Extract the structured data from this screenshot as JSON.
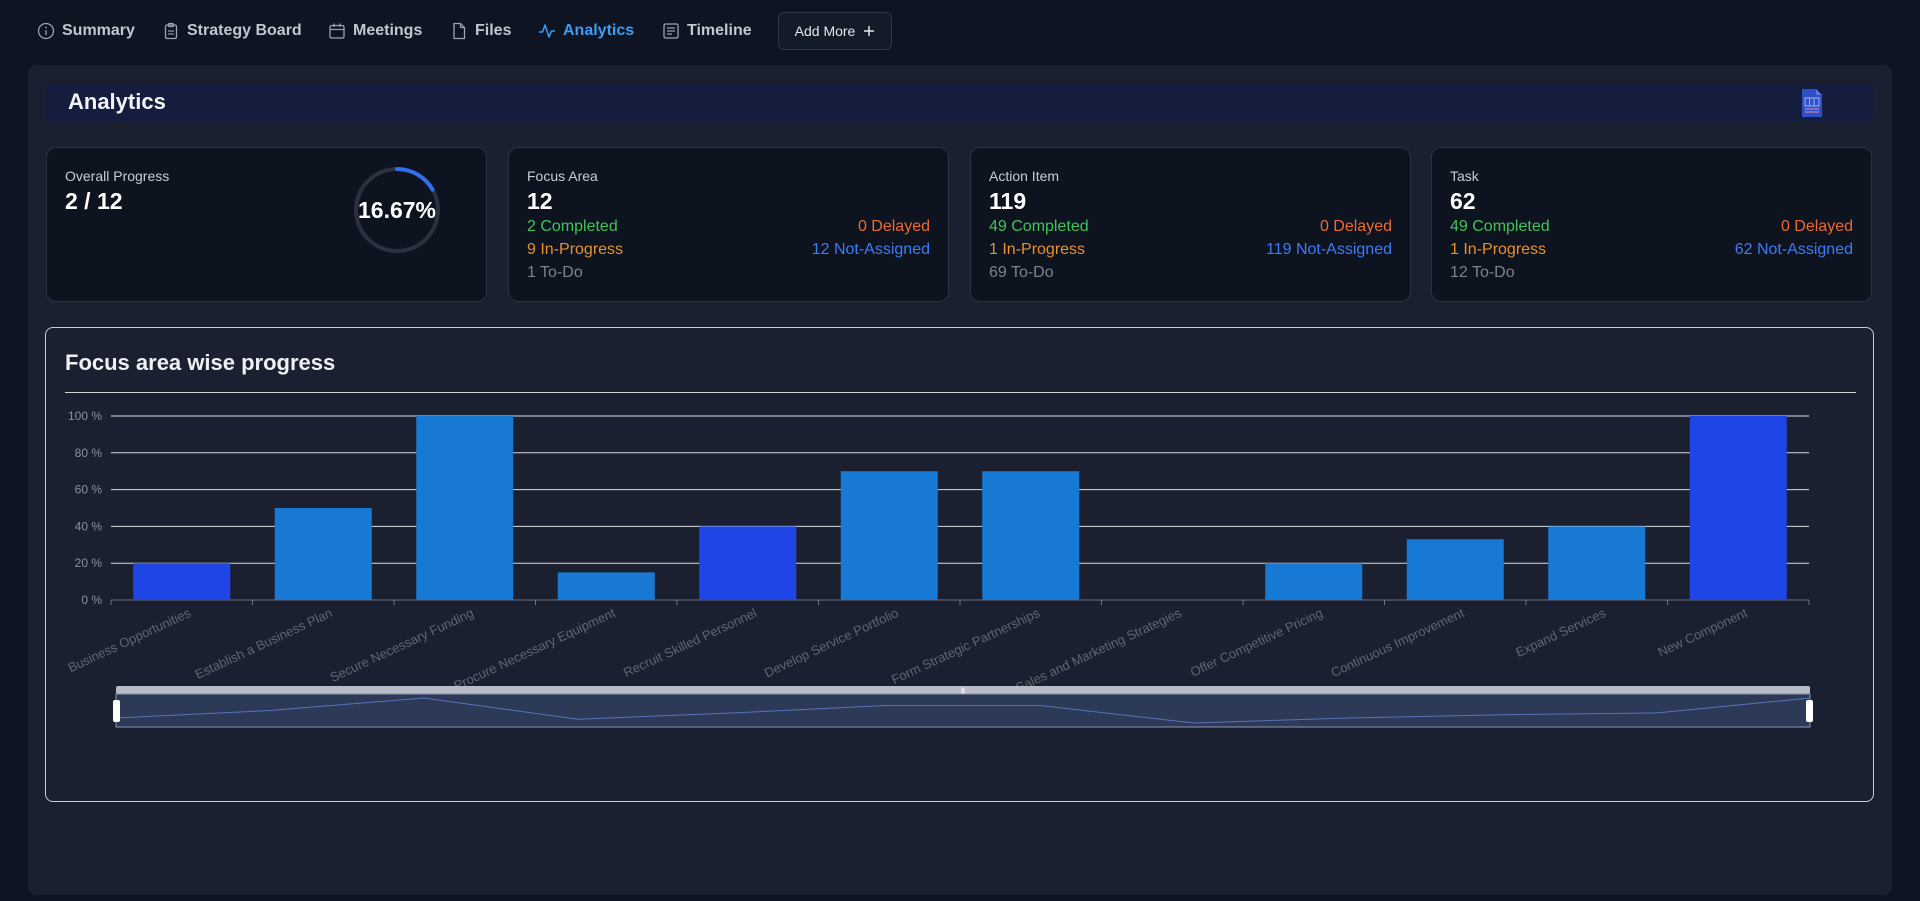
{
  "nav": {
    "items": [
      {
        "label": "Summary",
        "icon": "info-circle-icon"
      },
      {
        "label": "Strategy Board",
        "icon": "clipboard-icon"
      },
      {
        "label": "Meetings",
        "icon": "calendar-icon"
      },
      {
        "label": "Files",
        "icon": "file-icon"
      },
      {
        "label": "Analytics",
        "icon": "activity-icon"
      },
      {
        "label": "Timeline",
        "icon": "list-icon"
      }
    ],
    "active": "Analytics",
    "add_more": "Add More",
    "add_icon": "plus-icon"
  },
  "header": {
    "title": "Analytics",
    "export_icon": "document-icon"
  },
  "cards": {
    "overall": {
      "label": "Overall Progress",
      "value": "2 / 12",
      "percent": 16.67,
      "percent_text": "16.67%"
    },
    "focus": {
      "label": "Focus Area",
      "value": "12",
      "completed": "2 Completed",
      "delayed": "0 Delayed",
      "in_progress": "9 In-Progress",
      "not_assigned": "12 Not-Assigned",
      "todo": "1 To-Do"
    },
    "action": {
      "label": "Action Item",
      "value": "119",
      "completed": "49 Completed",
      "delayed": "0 Delayed",
      "in_progress": "1 In-Progress",
      "not_assigned": "119 Not-Assigned",
      "todo": "69 To-Do"
    },
    "task": {
      "label": "Task",
      "value": "62",
      "completed": "49 Completed",
      "delayed": "0 Delayed",
      "in_progress": "1 In-Progress",
      "not_assigned": "62 Not-Assigned",
      "todo": "12 To-Do"
    }
  },
  "colors": {
    "accent": "#3b9df4",
    "bar_dark": "#1f45e6",
    "bar_light": "#1779d4",
    "completed": "#3fc45a",
    "delayed": "#ee6a2f",
    "in_progress": "#e8902a",
    "not_assigned": "#3b7cf5"
  },
  "chart_title": "Focus area wise progress",
  "chart_data": {
    "type": "bar",
    "categories": [
      "Business Opportunities",
      "Establish a Business Plan",
      "Secure Necessary Funding",
      "Procure Necessary Equipment",
      "Recruit Skilled Personnel",
      "Develop Service Portfolio",
      "Form Strategic Partnerships",
      "Sales and Marketing Strategies",
      "Offer Competitive Pricing",
      "Continuous Improvement",
      "Expand Services",
      "New Component"
    ],
    "values": [
      20,
      50,
      100,
      15,
      40,
      70,
      70,
      0,
      20,
      33,
      40,
      100
    ],
    "yticks": [
      "0 %",
      "20 %",
      "40 %",
      "60 %",
      "80 %",
      "100 %"
    ],
    "ylim": [
      0,
      100
    ],
    "grid": true,
    "data_zoom": true
  }
}
